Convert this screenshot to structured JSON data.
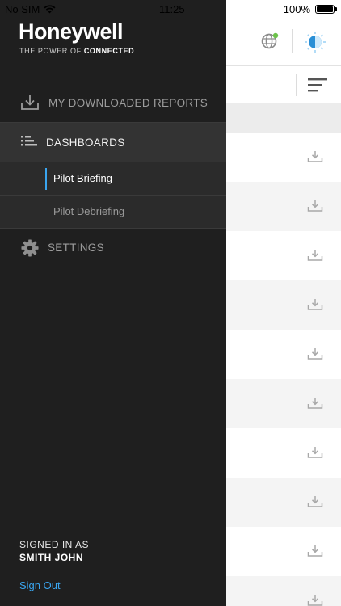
{
  "status_bar": {
    "carrier": "No SIM",
    "time": "11:25",
    "battery": "100%",
    "battery_level": 1.0
  },
  "drawer": {
    "brand": "Honeywell",
    "tagline_prefix": "THE POWER OF ",
    "tagline_bold": "CONNECTED",
    "menu": {
      "reports": "MY DOWNLOADED REPORTS",
      "dashboards": "DASHBOARDS",
      "dashboard_items": [
        {
          "label": "Pilot Briefing",
          "active": true
        },
        {
          "label": "Pilot Debriefing",
          "active": false
        }
      ],
      "settings": "SETTINGS"
    },
    "signed_in_label": "SIGNED IN AS",
    "signed_in_user": "SMITH JOHN",
    "sign_out": "Sign Out"
  },
  "background": {
    "row_count": 10,
    "icons": [
      "globe-icon",
      "theme-toggle-icon",
      "sort-icon",
      "download-icon"
    ]
  },
  "colors": {
    "drawer_bg": "#1f1f1f",
    "accent": "#3aa5ef",
    "globe_status": "#6cc24a"
  }
}
